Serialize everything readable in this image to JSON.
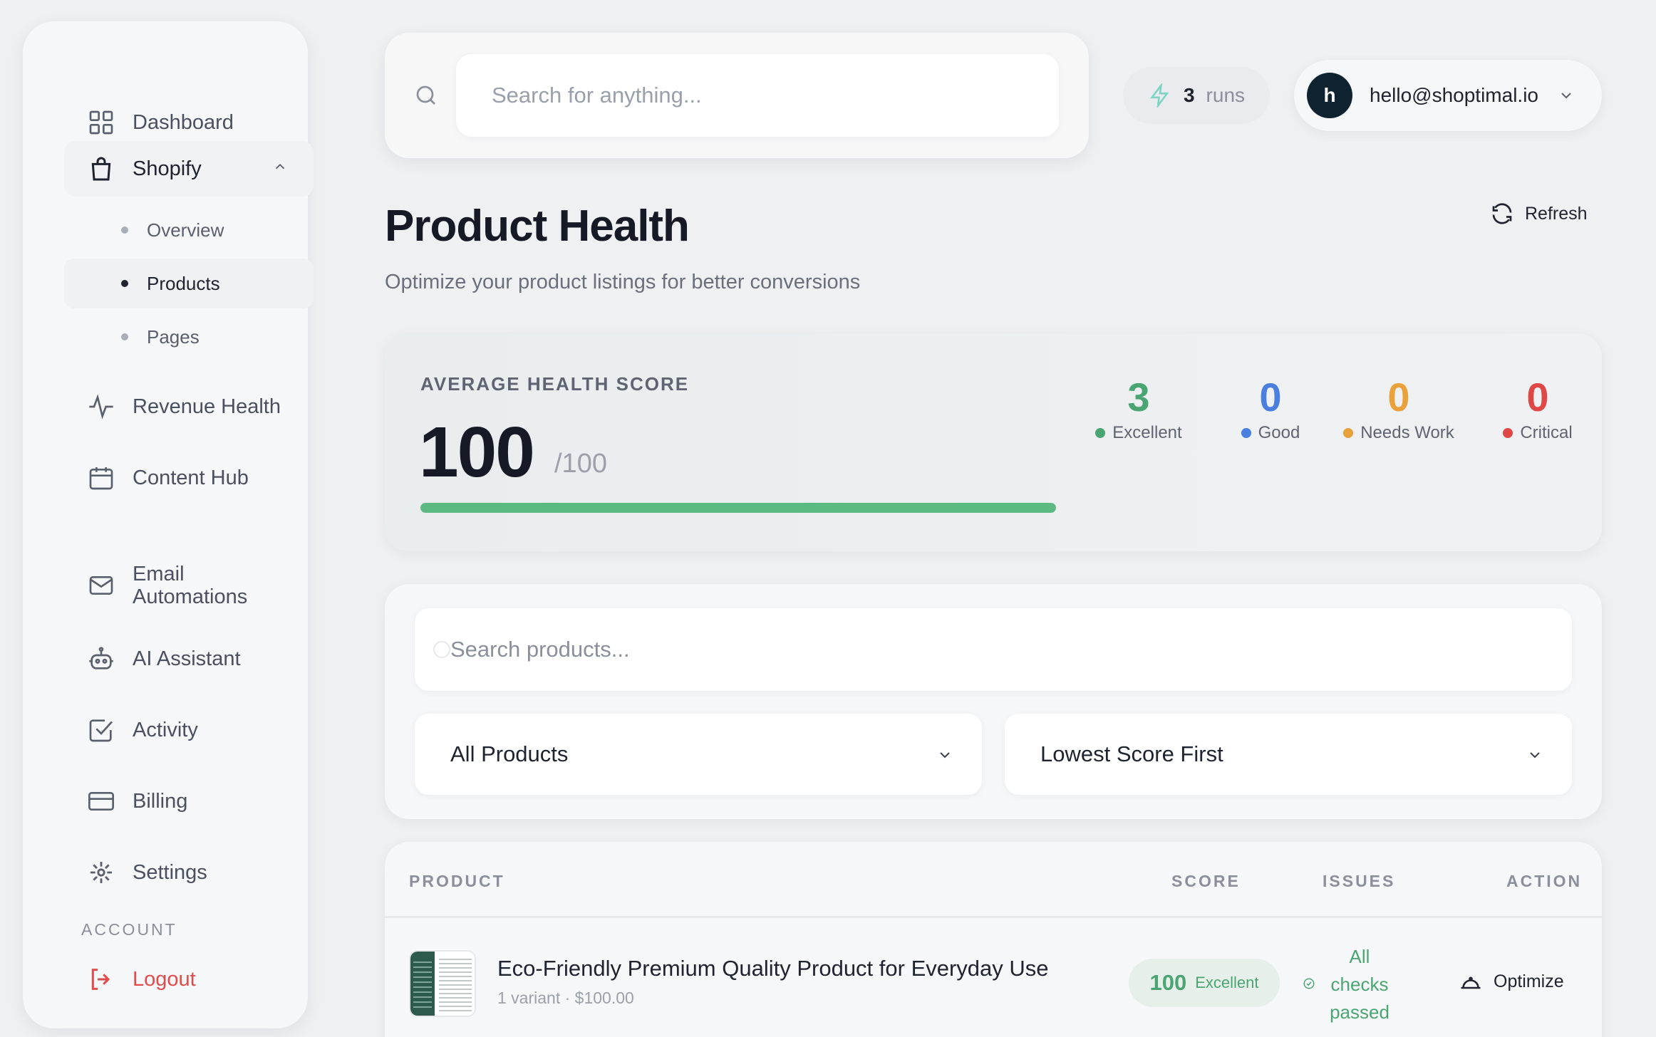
{
  "sidebar": {
    "items": [
      {
        "label": "Dashboard",
        "icon": "grid-icon"
      },
      {
        "label": "Shopify",
        "icon": "shopping-bag-icon"
      },
      {
        "label": "Revenue Health",
        "icon": "activity-icon"
      },
      {
        "label": "Content Hub",
        "icon": "calendar-icon"
      },
      {
        "label": "Email Automations",
        "icon": "mail-icon"
      },
      {
        "label": "AI Assistant",
        "icon": "robot-icon"
      },
      {
        "label": "Activity",
        "icon": "check-square-icon"
      },
      {
        "label": "Billing",
        "icon": "credit-card-icon"
      },
      {
        "label": "Settings",
        "icon": "gear-icon"
      }
    ],
    "shopify_sub": [
      {
        "label": "Overview"
      },
      {
        "label": "Products"
      },
      {
        "label": "Pages"
      }
    ],
    "account_label": "ACCOUNT",
    "logout_label": "Logout"
  },
  "topbar": {
    "search_placeholder": "Search for anything...",
    "runs_count": "3",
    "runs_label": "runs",
    "avatar_initial": "h",
    "user_email": "hello@shoptimal.io"
  },
  "header": {
    "title": "Product Health",
    "subtitle": "Optimize your product listings for better conversions",
    "refresh_label": "Refresh"
  },
  "score_card": {
    "label": "AVERAGE HEALTH SCORE",
    "score": "100",
    "max": "/100",
    "progress_percent": 100,
    "stats": [
      {
        "value": "3",
        "label": "Excellent",
        "color": "#4aa572"
      },
      {
        "value": "0",
        "label": "Good",
        "color": "#4a7fe0"
      },
      {
        "value": "0",
        "label": "Needs Work",
        "color": "#e9a23b"
      },
      {
        "value": "0",
        "label": "Critical",
        "color": "#e04848"
      }
    ]
  },
  "filters": {
    "search_placeholder": "Search products...",
    "category_selected": "All Products",
    "sort_selected": "Lowest Score First"
  },
  "table": {
    "headers": [
      "PRODUCT",
      "SCORE",
      "ISSUES",
      "ACTION"
    ],
    "rows": [
      {
        "name": "Eco-Friendly Premium Quality Product for Everyday Use",
        "meta": "1 variant · $100.00",
        "score": "100",
        "score_label": "Excellent",
        "issues": "All checks passed",
        "action": "Optimize"
      }
    ]
  },
  "colors": {
    "accent_green": "#5bb981",
    "logout_red": "#e34a4a",
    "avatar_bg": "#0f2230"
  }
}
